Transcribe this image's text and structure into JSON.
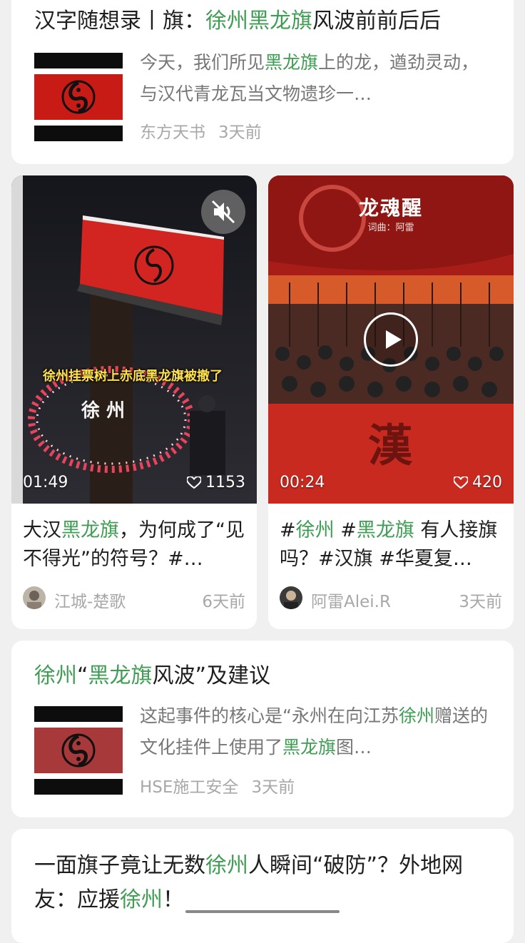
{
  "articles": [
    {
      "title_parts": [
        {
          "text": "汉字随想录丨旗：",
          "hl": false
        },
        {
          "text": "徐州黑龙旗",
          "hl": true
        },
        {
          "text": "风波前前后后",
          "hl": false
        }
      ],
      "snippet_parts": [
        {
          "text": "今天，我们所见",
          "hl": false
        },
        {
          "text": "黑龙旗",
          "hl": true
        },
        {
          "text": "上的龙，遒劲灵动，与汉代青龙瓦当文物遗珍一…",
          "hl": false
        }
      ],
      "source": "东方天书",
      "time": "3天前"
    },
    {
      "title_parts": [
        {
          "text": "徐州",
          "hl": true
        },
        {
          "text": "“",
          "hl": false
        },
        {
          "text": "黑龙旗",
          "hl": true
        },
        {
          "text": "风波”及建议",
          "hl": false
        }
      ],
      "snippet_parts": [
        {
          "text": "这起事件的核心是“永州在向江苏",
          "hl": false
        },
        {
          "text": "徐州",
          "hl": true
        },
        {
          "text": "赠送的文化挂件上使用了",
          "hl": false
        },
        {
          "text": "黑龙旗",
          "hl": true
        },
        {
          "text": "图…",
          "hl": false
        }
      ],
      "source": "HSE施工安全",
      "time": "3天前"
    },
    {
      "title_parts": [
        {
          "text": "一面旗子竟让无数",
          "hl": false
        },
        {
          "text": "徐州",
          "hl": true
        },
        {
          "text": "人瞬间“破防”？外地网友：应援",
          "hl": false
        },
        {
          "text": "徐州",
          "hl": true
        },
        {
          "text": "！",
          "hl": false
        }
      ]
    }
  ],
  "videos": [
    {
      "duration": "01:49",
      "likes": "1153",
      "overlay_text": "徐州挂票树上赤底黑龙旗被撤了",
      "caption_parts": [
        {
          "text": "大汉",
          "hl": false
        },
        {
          "text": "黑龙旗",
          "hl": true
        },
        {
          "text": "，为何成了“见不得光”的符号？#…",
          "hl": false
        }
      ],
      "author": "江城-楚歌",
      "time": "6天前"
    },
    {
      "duration": "00:24",
      "likes": "420",
      "song_title": "龙魂醒",
      "song_credit": "词曲：阿雷",
      "caption_parts": [
        {
          "text": "#",
          "hl": false
        },
        {
          "text": "徐州",
          "hl": true
        },
        {
          "text": " #",
          "hl": false
        },
        {
          "text": "黑龙旗",
          "hl": true
        },
        {
          "text": " 有人接旗吗？#汉旗 #华夏复…",
          "hl": false
        }
      ],
      "author": "阿雷Alei.R",
      "time": "3天前"
    }
  ],
  "colors": {
    "highlight": "#3f9d54",
    "flag_red": "#c81b16",
    "flag_black": "#0d0d0d",
    "page_bg": "#f0f0f0",
    "meta_gray": "#a8a8a8"
  },
  "icons": {
    "mute": "speaker-muted-icon",
    "play": "play-icon",
    "like": "heart-icon",
    "flag_emblem": "taiji-dragon-emblem"
  }
}
